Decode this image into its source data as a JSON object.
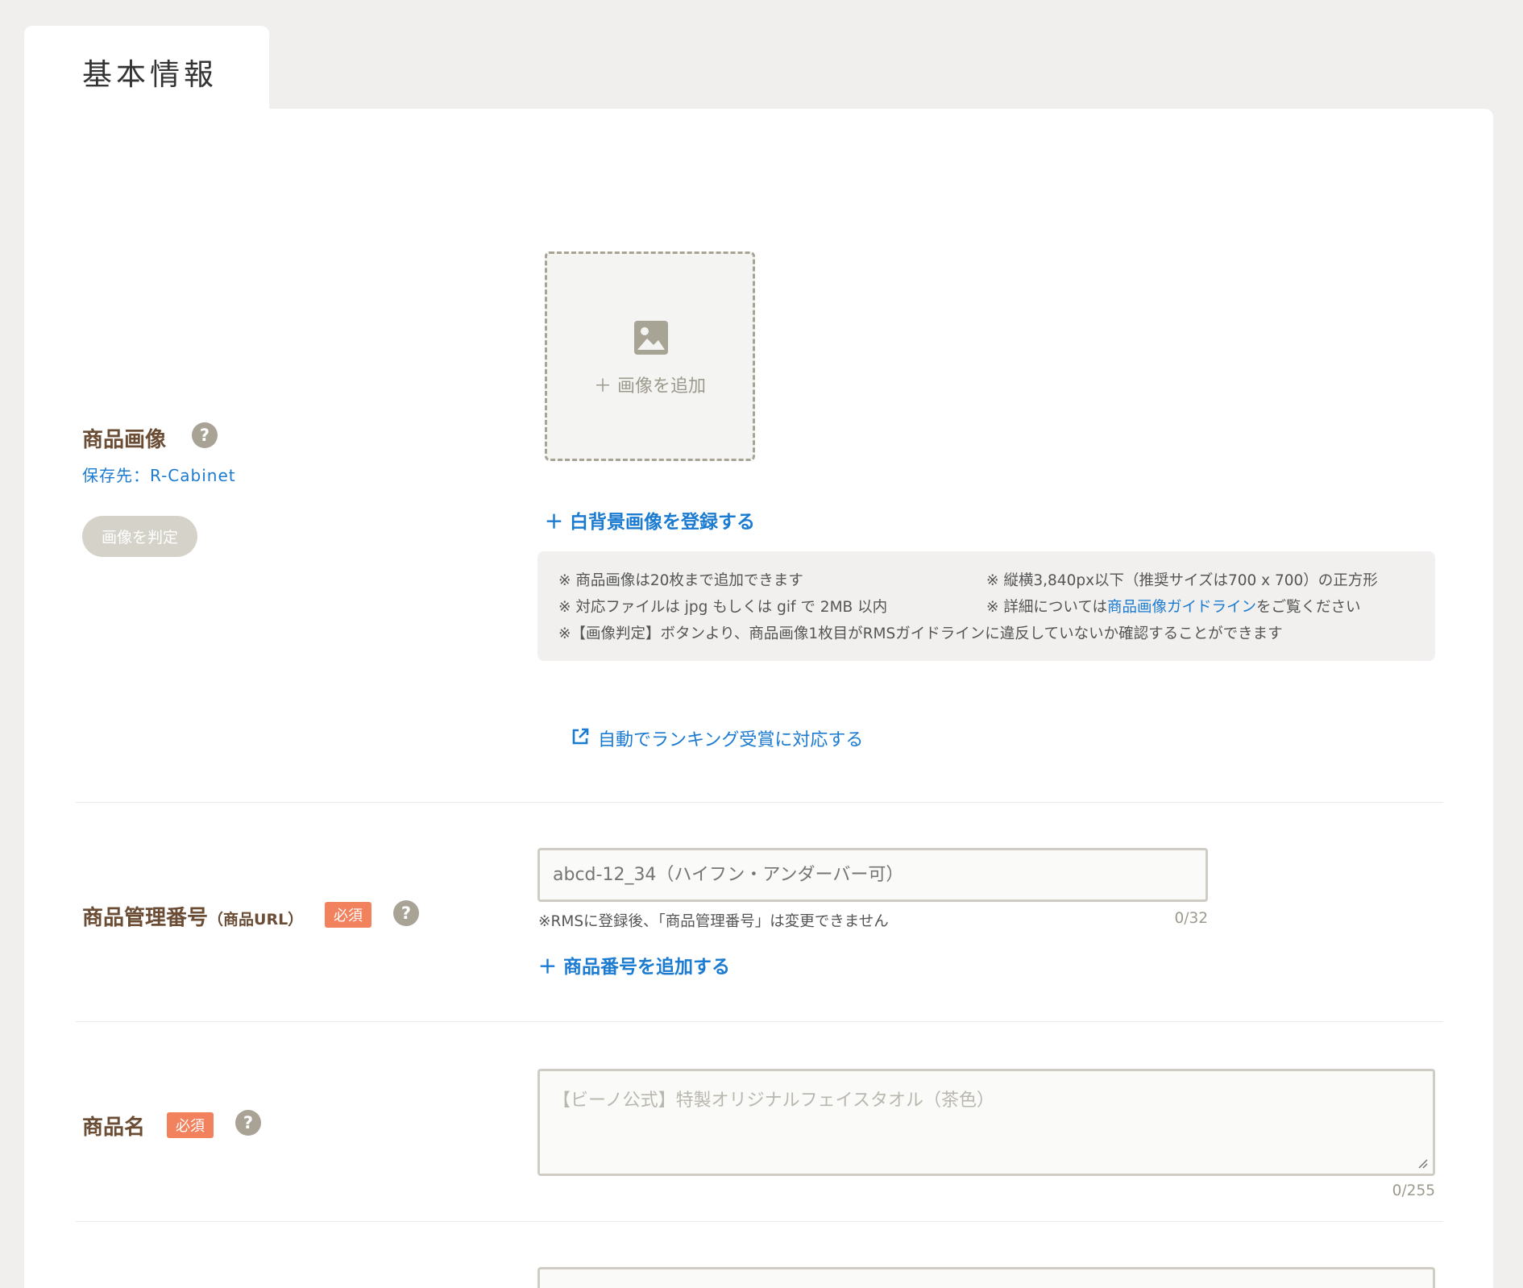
{
  "section": {
    "title": "基本情報"
  },
  "product_image": {
    "label": "商品画像",
    "help": "?",
    "storage": "保存先：R-Cabinet",
    "judge_button": "画像を判定",
    "add_image": "＋ 画像を追加",
    "add_white_bg": "＋ 白背景画像を登録する",
    "notes": {
      "n1": "※ 商品画像は20枚まで追加できます",
      "n2": "※ 縦横3,840px以下（推奨サイズは700 x 700）の正方形",
      "n3": "※ 対応ファイルは jpg もしくは gif で 2MB 以内",
      "n4_prefix": "※ 詳細については",
      "n4_link": "商品画像ガイドライン",
      "n4_suffix": "をご覧ください",
      "n5": "※【画像判定】ボタンより、商品画像1枚目がRMSガイドラインに違反していないか確認することができます"
    },
    "ranking_link": "自動でランキング受賞に対応する"
  },
  "management_number": {
    "label": "商品管理番号",
    "label_sub": "（商品URL）",
    "required": "必須",
    "help": "?",
    "placeholder": "abcd-12_34（ハイフン・アンダーバー可）",
    "hint": "※RMSに登録後、「商品管理番号」は変更できません",
    "count": "0/32",
    "add_link": "＋ 商品番号を追加する"
  },
  "product_name": {
    "label": "商品名",
    "required": "必須",
    "help": "?",
    "placeholder": "【ビーノ公式】特製オリジナルフェイスタオル（茶色）",
    "count": "0/255"
  },
  "colors": {
    "accent_blue": "#1b7bd1",
    "label_brown": "#6b4c34",
    "required_orange": "#f2815d"
  }
}
